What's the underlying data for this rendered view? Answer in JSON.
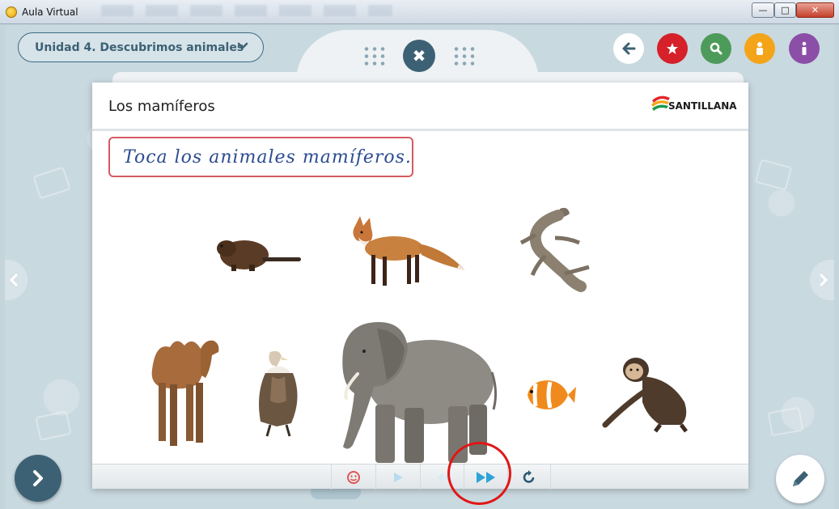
{
  "window": {
    "title": "Aula Virtual",
    "buttons": {
      "minimize": "—",
      "maximize": "□",
      "close": "✕"
    }
  },
  "toolbar": {
    "unit_selector": "Unidad 4. Descubrimos animales",
    "round_buttons": [
      {
        "name": "back",
        "icon": "arrow-left-icon",
        "color": "#ffffff"
      },
      {
        "name": "favorites",
        "icon": "star-icon",
        "color": "#d6202a"
      },
      {
        "name": "search",
        "icon": "search-icon",
        "color": "#4d9b5a"
      },
      {
        "name": "person",
        "icon": "person-icon",
        "color": "#f4a419"
      },
      {
        "name": "info",
        "icon": "info-icon",
        "color": "#8b4fa8"
      }
    ],
    "close_glyph": "✖"
  },
  "activity": {
    "title": "Los mamíferos",
    "brand": "SANTILLANA",
    "instruction": "Toca los animales mamíferos.",
    "animals": [
      {
        "name": "beaver"
      },
      {
        "name": "fox"
      },
      {
        "name": "lizard"
      },
      {
        "name": "camel"
      },
      {
        "name": "vulture"
      },
      {
        "name": "elephant"
      },
      {
        "name": "clownfish"
      },
      {
        "name": "monkey"
      }
    ],
    "controls": [
      {
        "name": "feedback",
        "icon": "feedback-face-icon"
      },
      {
        "name": "play",
        "icon": "play-icon"
      },
      {
        "name": "previous",
        "icon": "previous-icon"
      },
      {
        "name": "fast-forward",
        "icon": "fast-forward-icon"
      },
      {
        "name": "reset",
        "icon": "reset-icon"
      }
    ]
  },
  "colors": {
    "accent": "#3d6174",
    "instruction_border": "#d45b61",
    "instruction_text": "#2c4c90",
    "highlight": "#e01616"
  }
}
